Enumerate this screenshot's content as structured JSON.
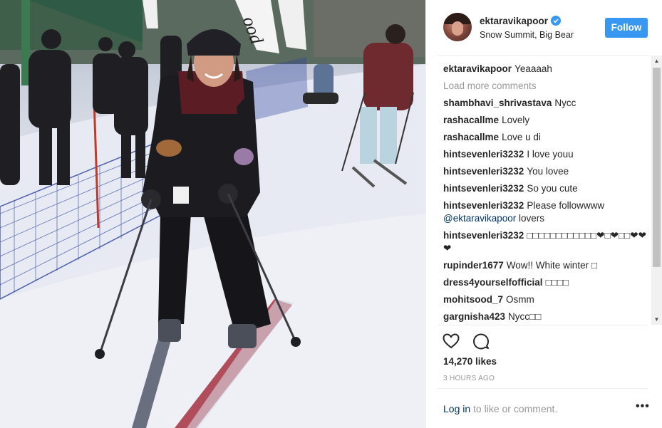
{
  "post": {
    "username": "ektaravikapoor",
    "location": "Snow Summit, Big Bear",
    "follow_label": "Follow",
    "caption_user": "ektaravikapoor",
    "caption_text": "Yeaaaah",
    "load_more": "Load more comments",
    "likes": "14,270 likes",
    "timestamp": "3 HOURS AGO",
    "login_link": "Log in",
    "login_rest": " to like or comment.",
    "more_label": "•••"
  },
  "comments": [
    {
      "user": "shambhavi_shrivastava",
      "text": "Nycc"
    },
    {
      "user": "rashacallme",
      "text": "Lovely"
    },
    {
      "user": "rashacallme",
      "text": "Love u di"
    },
    {
      "user": "hintsevenleri3232",
      "text": "I love youu"
    },
    {
      "user": "hintsevenleri3232",
      "text": "You lovee"
    },
    {
      "user": "hintsevenleri3232",
      "text": "So you cute"
    },
    {
      "user": "hintsevenleri3232",
      "text": "Please followwww",
      "mention": "@ektaravikapoor",
      "after": " lovers"
    },
    {
      "user": "hintsevenleri3232",
      "text": "□□□□□□□□□□□□❤□❤□□❤❤❤"
    },
    {
      "user": "rupinder1677",
      "text": "Wow!! White winter □"
    },
    {
      "user": "dress4yourselfofficial",
      "text": "□□□□"
    },
    {
      "user": "mohitsood_7",
      "text": "Osmm"
    },
    {
      "user": "gargnisha423",
      "text": "Nycc□□"
    }
  ],
  "banners": {
    "flag_text": "ood"
  },
  "colors": {
    "accent": "#3897f0",
    "link": "#003569"
  },
  "icons": [
    "verified-badge-icon",
    "heart-icon",
    "comment-icon",
    "more-options-icon",
    "scroll-up-icon",
    "scroll-down-icon"
  ]
}
